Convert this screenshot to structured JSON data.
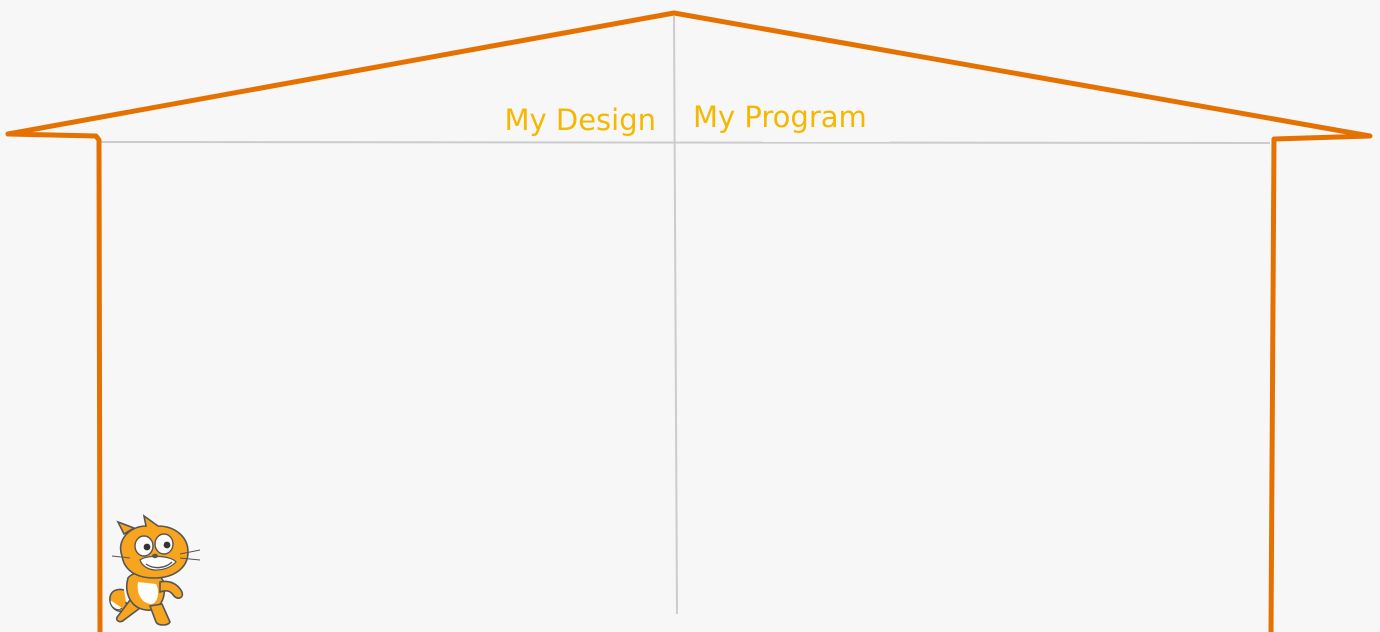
{
  "headings": {
    "design": "My Design",
    "program": "My Program"
  },
  "colors": {
    "house_outline": "#e57200",
    "divider": "#cccccc",
    "heading_text": "#f4b800",
    "background": "#f7f7f7"
  },
  "icons": {
    "mascot": "scratch-cat-icon"
  }
}
